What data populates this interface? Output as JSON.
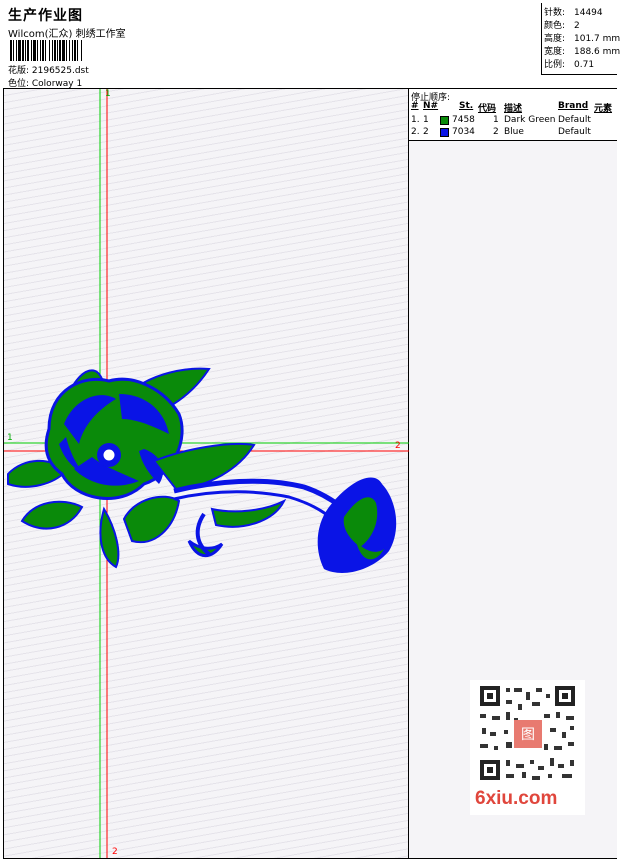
{
  "header": {
    "title": "生产作业图",
    "subtitle": "Wilcom(汇众) 刺绣工作室",
    "design_label": "花版: 2196525.dst",
    "colorway_label": "色位: Colorway 1"
  },
  "stats": [
    {
      "label": "针数:",
      "value": "14494"
    },
    {
      "label": "颜色:",
      "value": "2"
    },
    {
      "label": "高度:",
      "value": "101.7 mm"
    },
    {
      "label": "宽度:",
      "value": "188.6 mm"
    },
    {
      "label": "比例:",
      "value": "0.71"
    }
  ],
  "stop_sequence": {
    "title": "停止顺序:",
    "columns": [
      "#",
      "N#",
      "St.",
      "代码",
      "描述",
      "Brand",
      "元素"
    ],
    "rows": [
      {
        "index": "1.",
        "n": "1",
        "color": "#0a8a0a",
        "stitches": "7458",
        "code": "1",
        "description": "Dark Green",
        "brand": "Default"
      },
      {
        "index": "2.",
        "n": "2",
        "color": "#0a14e6",
        "stitches": "7034",
        "code": "2",
        "description": "Blue",
        "brand": "Default"
      }
    ]
  },
  "guides": {
    "green_h_label": "1",
    "red_h_label": "2",
    "green_v_label": "1",
    "red_v_label": "2"
  },
  "watermark": {
    "site": "6xiu.com",
    "seal": "图"
  }
}
